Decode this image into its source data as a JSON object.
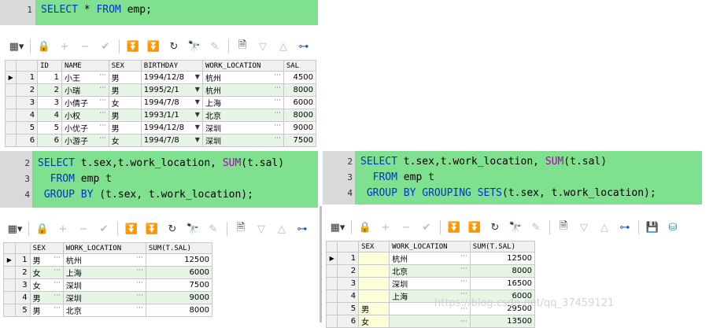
{
  "editor1": {
    "line": "1",
    "parts": [
      {
        "t": "SELECT",
        "k": "kw"
      },
      {
        "t": " * ",
        "k": ""
      },
      {
        "t": "FROM",
        "k": "kw"
      },
      {
        "t": " emp;",
        "k": ""
      }
    ]
  },
  "grid1": {
    "headers": [
      "ID",
      "NAME",
      "SEX",
      "BIRTHDAY",
      "WORK_LOCATION",
      "SAL"
    ],
    "rows": [
      [
        "1",
        "1",
        "小王",
        "男",
        "1994/12/8",
        "杭州",
        "4500"
      ],
      [
        "2",
        "2",
        "小瑞",
        "男",
        "1995/2/1",
        "杭州",
        "8000"
      ],
      [
        "3",
        "3",
        "小倩子",
        "女",
        "1994/7/8",
        "上海",
        "6000"
      ],
      [
        "4",
        "4",
        "小权",
        "男",
        "1993/1/1",
        "北京",
        "8000"
      ],
      [
        "5",
        "5",
        "小优子",
        "男",
        "1994/12/8",
        "深圳",
        "9000"
      ],
      [
        "6",
        "6",
        "小游子",
        "女",
        "1994/7/8",
        "深圳",
        "7500"
      ]
    ]
  },
  "editor2": {
    "lines": [
      {
        "n": "2",
        "parts": [
          {
            "t": "SELECT",
            "k": "kw"
          },
          {
            "t": " t.sex,t.work_location, ",
            "k": ""
          },
          {
            "t": "SUM",
            "k": "fn"
          },
          {
            "t": "(t.sal)",
            "k": ""
          }
        ]
      },
      {
        "n": "3",
        "parts": [
          {
            "t": "  FROM",
            "k": "kw"
          },
          {
            "t": " emp t",
            "k": ""
          }
        ]
      },
      {
        "n": "4",
        "parts": [
          {
            "t": " GROUP BY",
            "k": "kw"
          },
          {
            "t": " (t.sex, t.work_location);",
            "k": ""
          }
        ]
      }
    ]
  },
  "editor3": {
    "lines": [
      {
        "n": "2",
        "parts": [
          {
            "t": "SELECT",
            "k": "kw"
          },
          {
            "t": " t.sex,t.work_location, ",
            "k": ""
          },
          {
            "t": "SUM",
            "k": "fn"
          },
          {
            "t": "(t.sal)",
            "k": ""
          }
        ]
      },
      {
        "n": "3",
        "parts": [
          {
            "t": "  FROM",
            "k": "kw"
          },
          {
            "t": " emp t",
            "k": ""
          }
        ]
      },
      {
        "n": "4",
        "parts": [
          {
            "t": " GROUP BY GROUPING SETS",
            "k": "kw"
          },
          {
            "t": "(t.sex, t.work_location);",
            "k": ""
          }
        ]
      }
    ]
  },
  "grid2": {
    "headers": [
      "SEX",
      "WORK_LOCATION",
      "SUM(T.SAL)"
    ],
    "rows": [
      [
        "1",
        "男",
        "杭州",
        "12500"
      ],
      [
        "2",
        "女",
        "上海",
        "6000"
      ],
      [
        "3",
        "女",
        "深圳",
        "7500"
      ],
      [
        "4",
        "男",
        "深圳",
        "9000"
      ],
      [
        "5",
        "男",
        "北京",
        "8000"
      ]
    ]
  },
  "grid3": {
    "headers": [
      "SEX",
      "WORK_LOCATION",
      "SUM(T.SAL)"
    ],
    "rows": [
      [
        "1",
        "",
        "杭州",
        "12500"
      ],
      [
        "2",
        "",
        "北京",
        "8000"
      ],
      [
        "3",
        "",
        "深圳",
        "16500"
      ],
      [
        "4",
        "",
        "上海",
        "6000"
      ],
      [
        "5",
        "男",
        "",
        "29500"
      ],
      [
        "6",
        "女",
        "",
        "13500"
      ]
    ]
  },
  "watermark": "https://blog.csdn.net/qq_37459121"
}
